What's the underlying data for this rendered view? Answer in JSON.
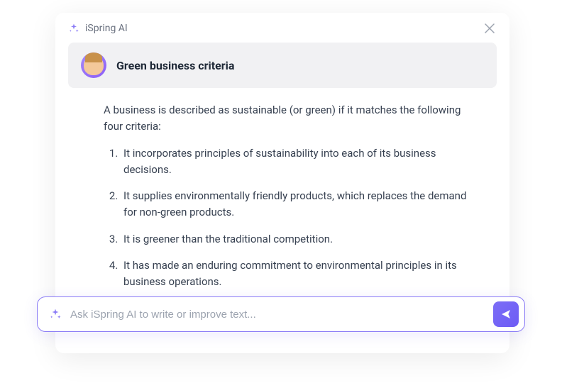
{
  "header": {
    "app_title": "iSpring AI"
  },
  "card": {
    "title": "Green business criteria"
  },
  "content": {
    "intro": "A business is described as sustainable (or green) if it matches the following four criteria:",
    "criteria": [
      "It incorporates principles of sustainability into each of its business decisions.",
      "It supplies environmentally friendly products, which replaces the demand for non-green products.",
      "It is greener than the traditional competition.",
      "It has made an enduring commitment to environmental principles in its business operations."
    ]
  },
  "input": {
    "placeholder": "Ask iSpring AI to write or improve text..."
  }
}
